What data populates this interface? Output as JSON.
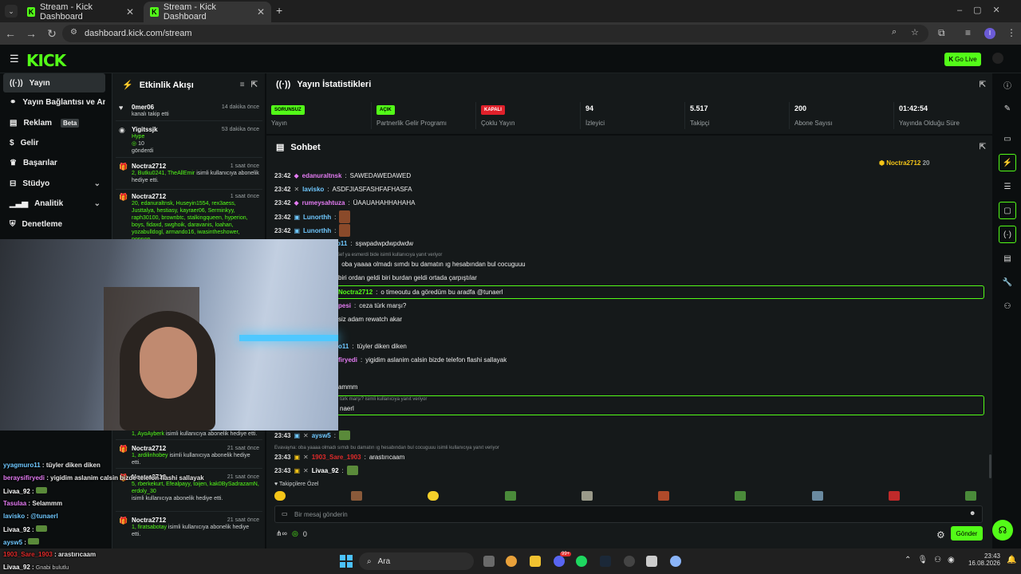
{
  "browser": {
    "tabs": [
      {
        "title": "Stream - Kick Dashboard"
      },
      {
        "title": "Stream - Kick Dashboard"
      }
    ],
    "url": "dashboard.kick.com/stream",
    "new_tab": "+",
    "profile_initial": "I"
  },
  "header": {
    "logo": "KICK",
    "go_live": "Go Live"
  },
  "sidebar": {
    "items": [
      {
        "label": "Yayın",
        "icon": "broadcast-icon"
      },
      {
        "label": "Yayın Bağlantısı ve Anahtarı",
        "icon": "link-icon"
      },
      {
        "label": "Reklam",
        "icon": "ad-icon",
        "badge": "Beta"
      },
      {
        "label": "Gelir",
        "icon": "dollar-icon"
      },
      {
        "label": "Başarılar",
        "icon": "trophy-icon"
      },
      {
        "label": "Stüdyo",
        "icon": "gamepad-icon"
      },
      {
        "label": "Analitik",
        "icon": "chart-icon"
      },
      {
        "label": "Denetleme",
        "icon": "shield-icon"
      }
    ]
  },
  "feed": {
    "title": "Etkinlik Akışı",
    "items": [
      {
        "name": "0mer06",
        "time": "14 dakika önce",
        "text": "kanalı takip etti"
      },
      {
        "name": "Yigitssjk",
        "time": "53 dakika önce",
        "hype": "Hype",
        "amount": "10",
        "text": "gönderdi"
      },
      {
        "name": "Noctra2712",
        "time": "1 saat önce",
        "users": "2, Butku0241, TheAllEmir",
        "text": "isimli kullanıcıya abonelik hediye etti."
      },
      {
        "name": "Noctra2712",
        "time": "1 saat önce",
        "users": "20, edanuraltnsk, Huseyin1554, rex3aess, Justtalya, hestiasy, kayraer06, Serminkyy, raph30100, brownbtc, stalkingqueen, hyperion, boys, fidaxd, swghoik, daravanis, loahan, yozabulldogl, armando16, iwasintheshower, popnop"
      },
      {
        "name": "",
        "time": "",
        "users": "1, AyoAyberk",
        "text": "isimli kullanıcıya abonelik hediye etti."
      },
      {
        "name": "Noctra2712",
        "time": "21 saat önce",
        "users": "1, ardilinhobey",
        "text": "isimli kullanıcıya abonelik hediye etti."
      },
      {
        "name": "Noctra2712",
        "time": "21 saat önce",
        "users": "5, rberkekurt, Efealpayy, toijen, kak0BySadrazamN, erdoly_30",
        "text": "isimli kullanıcıya abonelik hediye etti."
      },
      {
        "name": "Noctra2712",
        "time": "21 saat önce",
        "users": "1, firatsabotay",
        "text": "isimli kullanıcıya abonelik hediye etti."
      }
    ]
  },
  "stats": {
    "title": "Yayın İstatistikleri",
    "cards": [
      {
        "badge": "SORUNSUZ",
        "label": "Yayın",
        "color": "#53fc18",
        "text_color": "#000"
      },
      {
        "badge": "AÇIK",
        "label": "Partnerlik Gelir Programı",
        "color": "#53fc18",
        "text_color": "#000"
      },
      {
        "badge": "KAPALI",
        "label": "Çoklu Yayın",
        "color": "#e0202a",
        "text_color": "#fff"
      },
      {
        "value": "94",
        "label": "İzleyici"
      },
      {
        "value": "5.517",
        "label": "Takipçi"
      },
      {
        "value": "200",
        "label": "Abone Sayısı"
      },
      {
        "value": "01:42:54",
        "label": "Yayında Olduğu Süre"
      }
    ]
  },
  "chat": {
    "title": "Sohbet",
    "pinned_user": "Noctra2712",
    "pinned_count": "20",
    "messages": [
      {
        "time": "23:42",
        "user": "edanuraltnsk",
        "color": "#e37bf2",
        "text": "SAWEDAWEDAWED"
      },
      {
        "time": "23:42",
        "user": "lavisko",
        "color": "#6fc8ff",
        "text": "ASDFJIASFASHFAFHASFA"
      },
      {
        "time": "23:42",
        "user": "rumeysahtuza",
        "color": "#e37bf2",
        "text": "ÜAAUAHAHHAHAHA"
      },
      {
        "time": "23:42",
        "user": "Lunorthh",
        "color": "#6fc8ff",
        "text": ""
      },
      {
        "time": "23:42",
        "user": "Lunorthh",
        "color": "#6fc8ff",
        "text": ""
      },
      {
        "time": "",
        "user": "o11",
        "color": "#6fc8ff",
        "text": "sşwpadwpdwpdwdw"
      },
      {
        "reply": "Sef ya esmerdi bide isimli kullanıcıya yanıt veriyor"
      },
      {
        "time": "",
        "user": "",
        "color": "#fff",
        "text": "oba yaaaa olmadı sımdı bu damatın ıg hesabından bul cocuguuu"
      },
      {
        "time": "",
        "user": "",
        "color": "#fff",
        "text": "biri ordan geldi biri burdan geldi ortada çarpıştılar"
      },
      {
        "time": "",
        "user": "Noctra2712",
        "color": "#53fc18",
        "text": "o timeoutu da göredüm bu aradfa @tunaerl"
      },
      {
        "time": "",
        "user": "pesi",
        "color": "#e37bf2",
        "text": "ceza türk marşı?"
      },
      {
        "time": "",
        "user": "",
        "color": "#fff",
        "text": "siz adam rewatch akar"
      },
      {
        "time": "",
        "user": "o11",
        "color": "#6fc8ff",
        "text": "tüyler diken diken"
      },
      {
        "time": "",
        "user": "firyedi",
        "color": "#e37bf2",
        "text": "yigidim aslanim calsin bizde telefon flashi sallayak"
      },
      {
        "time": "",
        "user": "",
        "color": "#fff",
        "text": "ammm"
      },
      {
        "reply": "türk marşı? isimli kullanıcıya yanıt veriyor"
      },
      {
        "time": "",
        "user": "",
        "color": "#fff",
        "text": "naerl"
      },
      {
        "time": "23:43",
        "user": "aysw5",
        "color": "#6fc8ff",
        "text": ""
      },
      {
        "reply": "Evavayna: oba yaaaa olmadı sımdı bu damatın ıg hesabından bul cocuguuu isimli kullanıcıya yanıt veriyor"
      },
      {
        "time": "23:43",
        "user": "1903_Sare_1903",
        "color": "#e02a2a",
        "text": "arastırıcaam"
      },
      {
        "time": "23:43",
        "user": "Livaa_92",
        "color": "#fff",
        "text": ""
      }
    ],
    "emote_row_label": "Takipçilere Özel",
    "input_placeholder": "Bir mesaj gönderin",
    "points": "0",
    "send": "Gönder"
  },
  "overlay_chat": [
    {
      "user": "yyagmuro11",
      "color": "#6fc8ff",
      "text": "tüyler diken diken"
    },
    {
      "user": "beraysifiryedi",
      "color": "#e37bf2",
      "text": "yigidim aslanim calsin bizde telefon flashi sallayak"
    },
    {
      "user": "Livaa_92",
      "color": "#fff",
      "text": ""
    },
    {
      "user": "Tasulaa",
      "color": "#e37bf2",
      "text": "Selammm"
    },
    {
      "user": "lavisko",
      "color": "#6fc8ff",
      "text": "@tunaerl"
    },
    {
      "user": "Livaa_92",
      "color": "#fff",
      "text": ""
    },
    {
      "user": "aysw5",
      "color": "#6fc8ff",
      "text": ""
    },
    {
      "user": "1903_Sare_1903",
      "color": "#e02a2a",
      "text": "arastırıcaam"
    },
    {
      "user": "Livaa_92",
      "color": "#fff",
      "text": ""
    }
  ],
  "overlay_footer": "Gnabi bulutlu",
  "taskbar": {
    "search": "Ara",
    "time": "23:43",
    "date": "16.08.2026",
    "badge": "99+"
  }
}
